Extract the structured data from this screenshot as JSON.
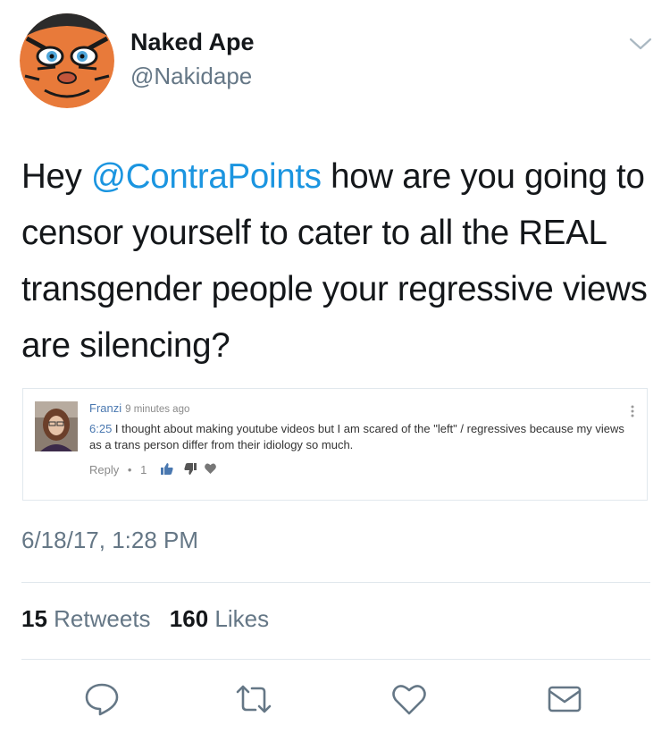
{
  "author": {
    "name": "Naked Ape",
    "handle": "@Nakidape"
  },
  "tweet": {
    "text_before": "Hey ",
    "mention": "@ContraPoints",
    "text_after": " how are you going to censor yourself to cater to all the REAL transgender people your regressive views are silencing?"
  },
  "embedded_comment": {
    "author": "Franzi",
    "time": "9 minutes ago",
    "timestamp_link": "6:25",
    "body": " I thought about making youtube videos but I am scared of the \"left\" / regressives because my views as a trans person differ from their idiology so much.",
    "reply_label": "Reply",
    "separator": "•",
    "like_count": "1"
  },
  "meta": {
    "date": "6/18/17, 1:28 PM"
  },
  "stats": {
    "retweets_count": "15",
    "retweets_label": "Retweets",
    "likes_count": "160",
    "likes_label": "Likes"
  },
  "colors": {
    "accent": "#1b95e0",
    "muted": "#657786",
    "text": "#14171a",
    "divider": "#e1e8ed"
  },
  "icons": {
    "caret": "chevron-down-icon",
    "reply": "reply-icon",
    "retweet": "retweet-icon",
    "like": "heart-icon",
    "dm": "envelope-icon"
  }
}
